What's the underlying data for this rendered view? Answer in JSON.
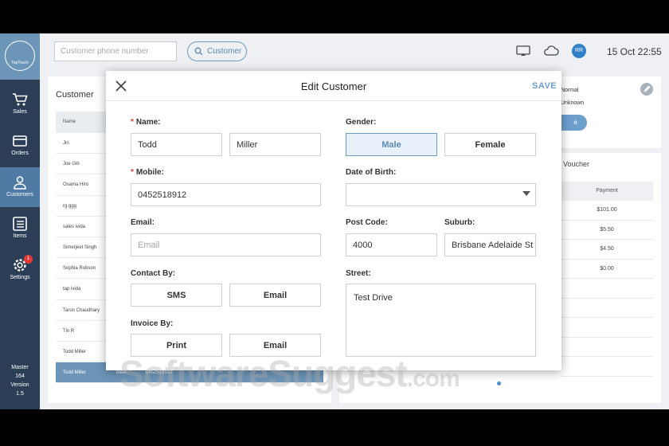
{
  "sidebar": {
    "logo": "TapTouch",
    "items": [
      {
        "label": "Sales"
      },
      {
        "label": "Orders"
      },
      {
        "label": "Customers"
      },
      {
        "label": "Items"
      },
      {
        "label": "Settings",
        "badge": "1"
      }
    ],
    "footer": [
      "Master",
      "164",
      "Version",
      "1.5"
    ]
  },
  "topbar": {
    "phone_placeholder": "Customer phone number",
    "customer_button": "Customer",
    "avatar": "RR",
    "datetime": "15 Oct 22:55"
  },
  "customer_panel": {
    "title": "Customer",
    "column_name": "Name",
    "rows": [
      "Jin",
      "Joe Gib",
      "Osama Hiro",
      "rg ggg",
      "sales ivida",
      "Simerjeet Singh",
      "Sophia Robson",
      "tap ivida",
      "Tarun Chaudhary",
      "Tin R",
      "Todd Miller"
    ],
    "selected": {
      "name": "Todd Miller",
      "gender": "Male",
      "mobile": "0452518912"
    }
  },
  "right_panel": {
    "radio_options": [
      "Normal",
      "Unknown"
    ],
    "button_fragment": "e",
    "voucher_title": "Voucher",
    "payment_header": "Payment",
    "payments": [
      "$101.00",
      "$5.50",
      "$4.50",
      "$0.00"
    ]
  },
  "modal": {
    "title": "Edit Customer",
    "save": "SAVE",
    "name_label": "Name:",
    "first_name": "Todd",
    "last_name": "Miller",
    "mobile_label": "Mobile:",
    "mobile": "0452518912",
    "email_label": "Email:",
    "email_placeholder": "Email",
    "contact_label": "Contact By:",
    "contact_options": [
      "SMS",
      "Email"
    ],
    "invoice_label": "Invoice By:",
    "invoice_options": [
      "Print",
      "Email"
    ],
    "gender_label": "Gender:",
    "gender_options": [
      "Male",
      "Female"
    ],
    "gender_selected": "Male",
    "dob_label": "Date of Birth:",
    "postcode_label": "Post Code:",
    "postcode": "4000",
    "suburb_label": "Suburb:",
    "suburb": "Brisbane Adelaide St",
    "street_label": "Street:",
    "street": "Test Drive"
  },
  "watermark": {
    "main": "SoftwareSuggest",
    "suffix": ".com"
  },
  "colors": {
    "sidebar": "#2c3e56",
    "active": "#4e7aa4",
    "accent": "#6c9ecb",
    "required": "#e53935"
  }
}
